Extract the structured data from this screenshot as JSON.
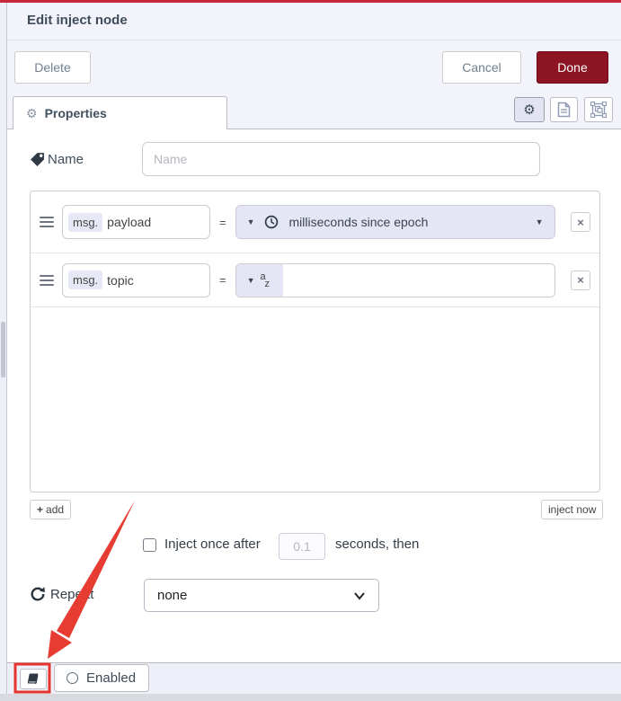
{
  "dialog": {
    "title": "Edit inject node",
    "buttons": {
      "delete": "Delete",
      "cancel": "Cancel",
      "done": "Done"
    },
    "tab": {
      "label": "Properties"
    },
    "name_field": {
      "label": "Name",
      "placeholder": "Name"
    },
    "props": {
      "rows": [
        {
          "prefix": "msg.",
          "key": "payload",
          "eq": "=",
          "value_type": "timestamp-icon",
          "value_label": "milliseconds since epoch"
        },
        {
          "prefix": "msg.",
          "key": "topic",
          "eq": "=",
          "value_type": "string-icon",
          "value_label": ""
        }
      ],
      "add_label": "add",
      "inject_now_label": "inject now"
    },
    "once": {
      "label_before": "Inject once after",
      "interval_placeholder": "0.1",
      "label_after": "seconds, then"
    },
    "repeat": {
      "label": "Repeat",
      "selected_option": "none"
    },
    "footer": {
      "enabled_label": "Enabled"
    }
  },
  "icons": {
    "caret_down": "▼",
    "close_x": "×",
    "plus": "+",
    "gear": "⚙"
  },
  "colors": {
    "top_bar_red": "#c62838",
    "done_button_bg": "#8d1423",
    "panel_lavender": "#f2f3fb",
    "control_lavender": "#e4e6f5",
    "annotation_red": "#e63c31"
  }
}
